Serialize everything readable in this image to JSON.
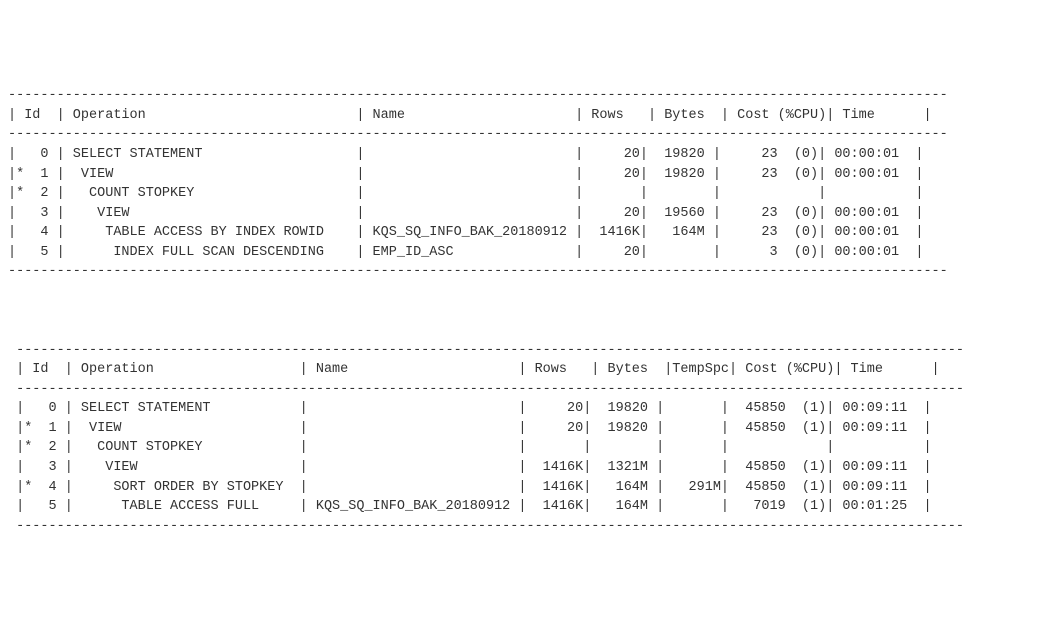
{
  "plan1": {
    "columns": [
      "Id",
      "Operation",
      "Name",
      "Rows",
      "Bytes",
      "Cost (%CPU)",
      "Time"
    ],
    "rows": [
      {
        "mark": " ",
        "id": "0",
        "operation": "SELECT STATEMENT",
        "name": "",
        "rows_": "20",
        "bytes": "19820",
        "cost": "23",
        "cpu": "(0)",
        "time": "00:00:01"
      },
      {
        "mark": "*",
        "id": "1",
        "operation": " VIEW",
        "name": "",
        "rows_": "20",
        "bytes": "19820",
        "cost": "23",
        "cpu": "(0)",
        "time": "00:00:01"
      },
      {
        "mark": "*",
        "id": "2",
        "operation": "  COUNT STOPKEY",
        "name": "",
        "rows_": "",
        "bytes": "",
        "cost": "",
        "cpu": "",
        "time": ""
      },
      {
        "mark": " ",
        "id": "3",
        "operation": "   VIEW",
        "name": "",
        "rows_": "20",
        "bytes": "19560",
        "cost": "23",
        "cpu": "(0)",
        "time": "00:00:01"
      },
      {
        "mark": " ",
        "id": "4",
        "operation": "    TABLE ACCESS BY INDEX ROWID",
        "name": "KQS_SQ_INFO_BAK_20180912",
        "rows_": "1416K",
        "bytes": "164M",
        "cost": "23",
        "cpu": "(0)",
        "time": "00:00:01"
      },
      {
        "mark": " ",
        "id": "5",
        "operation": "     INDEX FULL SCAN DESCENDING",
        "name": "EMP_ID_ASC",
        "rows_": "20",
        "bytes": "",
        "cost": "3",
        "cpu": "(0)",
        "time": "00:00:01"
      }
    ]
  },
  "plan2": {
    "columns": [
      "Id",
      "Operation",
      "Name",
      "Rows",
      "Bytes",
      "TempSpc",
      "Cost (%CPU)",
      "Time"
    ],
    "rows": [
      {
        "mark": " ",
        "id": "0",
        "operation": "SELECT STATEMENT",
        "name": "",
        "rows_": "20",
        "bytes": "19820",
        "temp": "",
        "cost": "45850",
        "cpu": "(1)",
        "time": "00:09:11"
      },
      {
        "mark": "*",
        "id": "1",
        "operation": " VIEW",
        "name": "",
        "rows_": "20",
        "bytes": "19820",
        "temp": "",
        "cost": "45850",
        "cpu": "(1)",
        "time": "00:09:11"
      },
      {
        "mark": "*",
        "id": "2",
        "operation": "  COUNT STOPKEY",
        "name": "",
        "rows_": "",
        "bytes": "",
        "temp": "",
        "cost": "",
        "cpu": "",
        "time": ""
      },
      {
        "mark": " ",
        "id": "3",
        "operation": "   VIEW",
        "name": "",
        "rows_": "1416K",
        "bytes": "1321M",
        "temp": "",
        "cost": "45850",
        "cpu": "(1)",
        "time": "00:09:11"
      },
      {
        "mark": "*",
        "id": "4",
        "operation": "    SORT ORDER BY STOPKEY",
        "name": "",
        "rows_": "1416K",
        "bytes": "164M",
        "temp": "291M",
        "cost": "45850",
        "cpu": "(1)",
        "time": "00:09:11"
      },
      {
        "mark": " ",
        "id": "5",
        "operation": "     TABLE ACCESS FULL",
        "name": "KQS_SQ_INFO_BAK_20180912",
        "rows_": "1416K",
        "bytes": "164M",
        "temp": "",
        "cost": "7019",
        "cpu": "(1)",
        "time": "00:01:25"
      }
    ]
  }
}
